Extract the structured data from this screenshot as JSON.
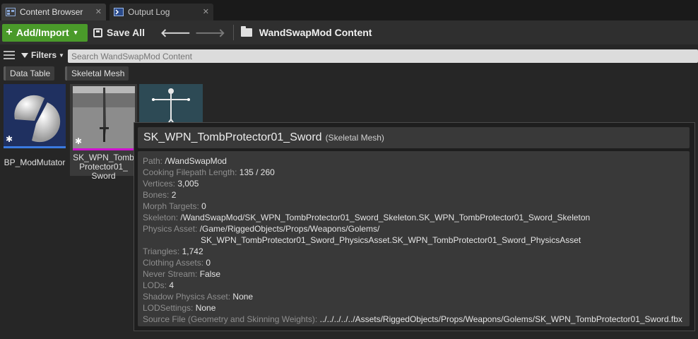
{
  "tabs": [
    {
      "label": "Content Browser",
      "icon": "content-browser-icon"
    },
    {
      "label": "Output Log",
      "icon": "output-log-icon"
    }
  ],
  "toolbar": {
    "add_import_label": "Add/Import",
    "save_all_label": "Save All",
    "breadcrumb": "WandSwapMod Content"
  },
  "filters": {
    "label": "Filters",
    "search_placeholder": "Search WandSwapMod Content",
    "chips": [
      "Data Table",
      "Skeletal Mesh"
    ]
  },
  "assets": [
    {
      "name": "BP_ModMutator"
    },
    {
      "name_lines": [
        "SK_WPN_Tomb",
        "Protector01_",
        "Sword"
      ]
    },
    {
      "name": ""
    }
  ],
  "tooltip": {
    "title": "SK_WPN_TombProtector01_Sword",
    "type": "(Skeletal Mesh)",
    "rows": [
      {
        "key": "Path:",
        "value": "/WandSwapMod"
      },
      {
        "key": "Cooking Filepath Length:",
        "value": "135 / 260"
      },
      {
        "key": "Vertices:",
        "value": "3,005"
      },
      {
        "key": "Bones:",
        "value": "2"
      },
      {
        "key": "Morph Targets:",
        "value": "0"
      },
      {
        "key": "Skeleton:",
        "value": "/WandSwapMod/SK_WPN_TombProtector01_Sword_Skeleton.SK_WPN_TombProtector01_Sword_Skeleton"
      },
      {
        "key": "Physics Asset:",
        "value": "/Game/RiggedObjects/Props/Weapons/Golems/",
        "value_cont": "SK_WPN_TombProtector01_Sword_PhysicsAsset.SK_WPN_TombProtector01_Sword_PhysicsAsset"
      },
      {
        "key": "Triangles:",
        "value": "1,742"
      },
      {
        "key": "Clothing Assets:",
        "value": "0"
      },
      {
        "key": "Never Stream:",
        "value": "False"
      },
      {
        "key": "LODs:",
        "value": "4"
      },
      {
        "key": "Shadow Physics Asset:",
        "value": "None"
      },
      {
        "key": "LODSettings:",
        "value": "None"
      },
      {
        "key": "Source File (Geometry and Skinning Weights):",
        "value": "../../../../../Assets/RiggedObjects/Props/Weapons/Golems/SK_WPN_TombProtector01_Sword.fbx"
      }
    ]
  }
}
